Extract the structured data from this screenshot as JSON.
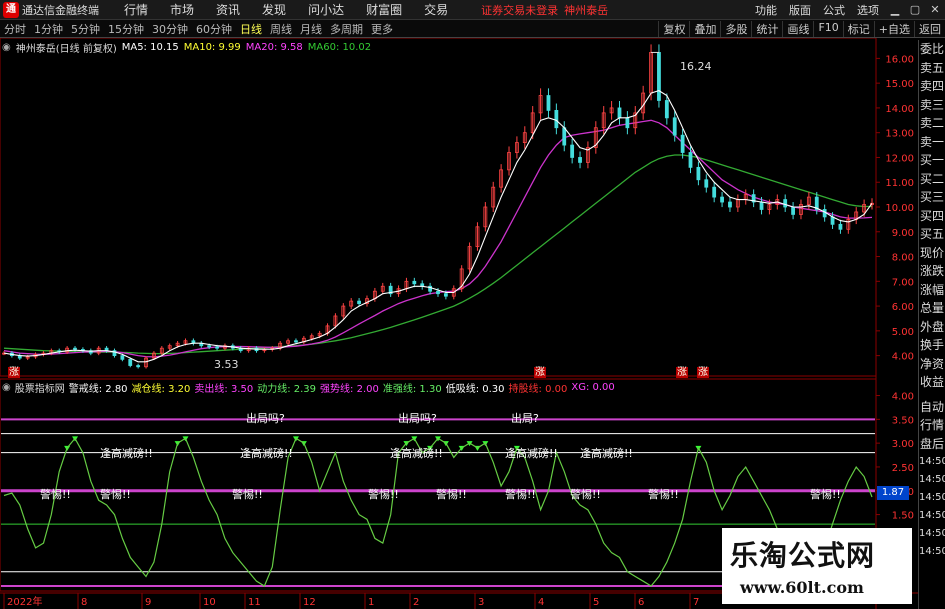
{
  "app": {
    "logo_glyph": "通",
    "title": "通达信金融终端",
    "menus": [
      "行情",
      "市场",
      "资讯",
      "发现",
      "问小达",
      "财富圈",
      "交易"
    ],
    "login_status": "证券交易未登录",
    "stock_name": "神州泰岳",
    "right_menus": [
      "功能",
      "版面",
      "公式",
      "选项"
    ],
    "window_buttons": [
      "▁",
      "▢",
      "✕"
    ]
  },
  "periods": [
    "分时",
    "1分钟",
    "5分钟",
    "15分钟",
    "30分钟",
    "60分钟",
    "日线",
    "周线",
    "月线",
    "多周期",
    "更多"
  ],
  "active_period": "日线",
  "period_tools": [
    "复权",
    "叠加",
    "多股",
    "统计",
    "画线",
    "F10",
    "标记",
    "+自选",
    "返回"
  ],
  "price_chart": {
    "title": "神州泰岳(日线 前复权)",
    "ma": [
      {
        "label": "MA5: 10.15",
        "color": "#ffffff"
      },
      {
        "label": "MA10: 9.99",
        "color": "#ffff33"
      },
      {
        "label": "MA20: 9.58",
        "color": "#ff44ff"
      },
      {
        "label": "MA60: 10.02",
        "color": "#33cc33"
      }
    ],
    "y_ticks": [
      "16.00",
      "15.00",
      "14.00",
      "13.00",
      "12.00",
      "11.00",
      "10.00",
      "9.00",
      "8.00",
      "7.00",
      "6.00",
      "5.00",
      "4.00"
    ],
    "high_label": "16.24",
    "low_label": "3.53",
    "signals": [
      "涨",
      "涨",
      "涨",
      "涨"
    ]
  },
  "indicator": {
    "title": "股票指标网",
    "lines": [
      {
        "label": "警戒线: 2.80",
        "color": "#ffffff"
      },
      {
        "label": "减仓线: 3.20",
        "color": "#ffff33"
      },
      {
        "label": "卖出线: 3.50",
        "color": "#ff44ff"
      },
      {
        "label": "动力线: 2.39",
        "color": "#66ee66"
      },
      {
        "label": "强势线: 2.00",
        "color": "#ff44ff"
      },
      {
        "label": "准强线: 1.30",
        "color": "#66ee66"
      },
      {
        "label": "低吸线: 0.30",
        "color": "#ffffff"
      },
      {
        "label": "持股线: 0.00",
        "color": "#ff3333"
      },
      {
        "label": "XG: 0.00",
        "color": "#ff44ff"
      }
    ],
    "y_ticks": [
      "4.00",
      "3.50",
      "3.00",
      "2.50",
      "2.00",
      "1.50"
    ],
    "current_value": "1.87",
    "label_out": "出局吗?",
    "label_out2": "出局?",
    "label_caution": "逢高减磅!!",
    "label_hold": "警惕!!"
  },
  "x_axis": [
    "2022年",
    "8",
    "9",
    "10",
    "11",
    "12",
    "1",
    "2",
    "3",
    "4",
    "5",
    "6",
    "7"
  ],
  "sidebar": {
    "quote_items": [
      "委比",
      "卖五",
      "卖四",
      "卖三",
      "卖二",
      "卖一",
      "买一",
      "买二",
      "买三",
      "买四",
      "买五",
      "现价",
      "涨跌",
      "涨幅",
      "总量",
      "外盘",
      "换手",
      "净资",
      "收益"
    ],
    "lower_items": [
      "自动",
      "行情",
      "盘后"
    ],
    "times": [
      "14:50",
      "14:50",
      "14:50",
      "14:50",
      "14:50",
      "14:50",
      "14:50",
      "14:50"
    ]
  },
  "watermark": {
    "text": "乐淘公式网",
    "url": "www.60lt.com"
  },
  "chart_data": {
    "type": "line",
    "price_series": {
      "x": [
        0,
        2,
        4,
        6,
        8,
        10,
        12,
        14,
        16,
        18,
        20,
        22,
        24,
        26,
        28,
        30,
        32,
        34,
        36,
        38,
        40,
        42,
        44,
        46,
        48,
        50,
        52,
        54,
        56,
        58,
        60,
        62,
        64,
        66,
        68,
        70,
        72,
        74,
        76,
        78,
        80,
        82,
        84,
        86,
        88,
        90,
        92,
        94,
        96,
        98,
        100,
        102,
        104,
        106,
        108,
        110,
        112,
        114,
        116,
        118,
        120,
        122,
        124,
        126,
        128,
        130,
        132,
        134,
        136,
        138,
        140,
        142,
        144,
        146,
        148,
        150,
        152,
        154,
        156,
        158,
        160,
        162,
        164,
        166,
        168,
        170,
        172,
        174,
        176,
        178,
        180,
        182,
        184,
        186,
        188,
        190,
        192,
        194,
        196,
        198,
        200,
        202,
        204,
        206,
        208,
        210,
        212,
        214,
        216,
        218,
        220
      ],
      "close": [
        4.1,
        4.0,
        3.9,
        3.95,
        4.05,
        4.1,
        4.2,
        4.15,
        4.3,
        4.25,
        4.2,
        4.1,
        4.3,
        4.2,
        4.0,
        3.85,
        3.6,
        3.55,
        3.9,
        4.1,
        4.3,
        4.4,
        4.5,
        4.6,
        4.5,
        4.4,
        4.35,
        4.3,
        4.4,
        4.3,
        4.2,
        4.3,
        4.2,
        4.25,
        4.3,
        4.5,
        4.6,
        4.55,
        4.7,
        4.8,
        4.9,
        5.2,
        5.6,
        6.0,
        6.2,
        6.1,
        6.3,
        6.6,
        6.8,
        6.5,
        6.7,
        7.0,
        6.9,
        6.8,
        6.6,
        6.5,
        6.4,
        6.7,
        7.5,
        8.4,
        9.2,
        10.0,
        10.8,
        11.5,
        12.2,
        12.6,
        13.0,
        13.8,
        14.5,
        13.9,
        13.2,
        12.5,
        12.0,
        11.8,
        12.4,
        13.2,
        13.8,
        14.0,
        13.6,
        13.2,
        13.8,
        14.6,
        16.24,
        14.3,
        13.6,
        12.9,
        12.2,
        11.6,
        11.1,
        10.8,
        10.4,
        10.2,
        10.0,
        10.3,
        10.5,
        10.2,
        9.9,
        10.1,
        10.3,
        10.0,
        9.7,
        10.1,
        10.4,
        9.9,
        9.6,
        9.3,
        9.1,
        9.5,
        9.8,
        10.1,
        10.15
      ],
      "ma5": [
        4.1,
        4.05,
        4.0,
        3.98,
        4.0,
        4.05,
        4.1,
        4.15,
        4.2,
        4.22,
        4.2,
        4.18,
        4.2,
        4.2,
        4.15,
        4.05,
        3.9,
        3.75,
        3.75,
        3.85,
        4.0,
        4.2,
        4.35,
        4.45,
        4.5,
        4.5,
        4.45,
        4.4,
        4.38,
        4.35,
        4.3,
        4.28,
        4.26,
        4.26,
        4.26,
        4.3,
        4.4,
        4.48,
        4.56,
        4.65,
        4.75,
        4.9,
        5.15,
        5.45,
        5.8,
        6.0,
        6.15,
        6.3,
        6.5,
        6.55,
        6.6,
        6.7,
        6.8,
        6.8,
        6.75,
        6.65,
        6.55,
        6.55,
        6.8,
        7.3,
        8.0,
        8.8,
        9.6,
        10.4,
        11.1,
        11.8,
        12.3,
        12.9,
        13.5,
        13.6,
        13.5,
        13.2,
        12.8,
        12.4,
        12.3,
        12.5,
        12.9,
        13.4,
        13.6,
        13.6,
        13.7,
        14.1,
        14.6,
        14.7,
        14.5,
        13.9,
        13.2,
        12.5,
        11.9,
        11.4,
        11.0,
        10.7,
        10.4,
        10.3,
        10.3,
        10.25,
        10.2,
        10.15,
        10.2,
        10.1,
        10.0,
        10.0,
        10.05,
        9.95,
        9.8,
        9.6,
        9.45,
        9.4,
        9.5,
        9.7,
        10.15
      ],
      "ma20": [
        4.2,
        4.15,
        4.1,
        4.08,
        4.06,
        4.05,
        4.06,
        4.08,
        4.1,
        4.12,
        4.14,
        4.15,
        4.16,
        4.17,
        4.16,
        4.12,
        4.06,
        4.0,
        3.96,
        3.95,
        3.98,
        4.02,
        4.08,
        4.15,
        4.22,
        4.28,
        4.32,
        4.35,
        4.36,
        4.37,
        4.37,
        4.36,
        4.35,
        4.34,
        4.33,
        4.34,
        4.36,
        4.38,
        4.42,
        4.47,
        4.53,
        4.62,
        4.75,
        4.92,
        5.1,
        5.28,
        5.45,
        5.62,
        5.8,
        5.95,
        6.1,
        6.22,
        6.32,
        6.42,
        6.5,
        6.55,
        6.58,
        6.6,
        6.7,
        6.9,
        7.2,
        7.6,
        8.1,
        8.6,
        9.2,
        9.8,
        10.4,
        11.0,
        11.6,
        12.1,
        12.5,
        12.8,
        12.9,
        12.95,
        13.0,
        13.05,
        13.1,
        13.2,
        13.3,
        13.35,
        13.4,
        13.45,
        13.5,
        13.4,
        13.2,
        12.9,
        12.6,
        12.3,
        12.0,
        11.7,
        11.4,
        11.1,
        10.9,
        10.7,
        10.55,
        10.4,
        10.3,
        10.2,
        10.15,
        10.1,
        10.0,
        9.95,
        9.9,
        9.85,
        9.8,
        9.7,
        9.6,
        9.55,
        9.55,
        9.56,
        9.58
      ],
      "ma60": [
        4.3,
        4.28,
        4.26,
        4.24,
        4.22,
        4.2,
        4.19,
        4.18,
        4.17,
        4.16,
        4.15,
        4.14,
        4.14,
        4.14,
        4.14,
        4.13,
        4.12,
        4.1,
        4.09,
        4.08,
        4.08,
        4.09,
        4.1,
        4.12,
        4.14,
        4.16,
        4.18,
        4.2,
        4.22,
        4.24,
        4.26,
        4.28,
        4.3,
        4.32,
        4.34,
        4.36,
        4.38,
        4.4,
        4.43,
        4.46,
        4.5,
        4.55,
        4.6,
        4.66,
        4.72,
        4.8,
        4.88,
        4.96,
        5.05,
        5.14,
        5.24,
        5.34,
        5.44,
        5.55,
        5.66,
        5.77,
        5.88,
        6.0,
        6.15,
        6.32,
        6.5,
        6.7,
        6.92,
        7.15,
        7.4,
        7.65,
        7.9,
        8.15,
        8.4,
        8.65,
        8.9,
        9.15,
        9.4,
        9.65,
        9.9,
        10.15,
        10.4,
        10.65,
        10.9,
        11.15,
        11.4,
        11.6,
        11.8,
        11.95,
        12.05,
        12.1,
        12.1,
        12.05,
        12.0,
        11.9,
        11.8,
        11.7,
        11.6,
        11.5,
        11.4,
        11.3,
        11.2,
        11.1,
        11.0,
        10.9,
        10.8,
        10.7,
        10.6,
        10.5,
        10.4,
        10.3,
        10.2,
        10.1,
        10.05,
        10.02,
        10.02
      ],
      "ylim": [
        3.5,
        16.5
      ]
    },
    "indicator_series": {
      "x": [
        0,
        2,
        4,
        6,
        8,
        10,
        12,
        14,
        16,
        18,
        20,
        22,
        24,
        26,
        28,
        30,
        32,
        34,
        36,
        38,
        40,
        42,
        44,
        46,
        48,
        50,
        52,
        54,
        56,
        58,
        60,
        62,
        64,
        66,
        68,
        70,
        72,
        74,
        76,
        78,
        80,
        82,
        84,
        86,
        88,
        90,
        92,
        94,
        96,
        98,
        100,
        102,
        104,
        106,
        108,
        110,
        112,
        114,
        116,
        118,
        120,
        122,
        124,
        126,
        128,
        130,
        132,
        134,
        136,
        138,
        140,
        142,
        144,
        146,
        148,
        150,
        152,
        154,
        156,
        158,
        160,
        162,
        164,
        166,
        168,
        170,
        172,
        174,
        176,
        178,
        180,
        182,
        184,
        186,
        188,
        190,
        192,
        194,
        196,
        198,
        200,
        202,
        204,
        206,
        208,
        210,
        212,
        214,
        216,
        218,
        220
      ],
      "power": [
        1.9,
        1.95,
        1.7,
        1.2,
        0.8,
        0.9,
        1.5,
        2.4,
        2.9,
        3.1,
        2.8,
        2.2,
        1.8,
        1.7,
        1.5,
        1.0,
        0.6,
        0.4,
        0.2,
        0.5,
        1.3,
        2.4,
        3.0,
        3.1,
        2.7,
        2.2,
        1.8,
        1.5,
        1.0,
        0.7,
        0.5,
        0.3,
        0.1,
        0.0,
        0.4,
        1.6,
        2.7,
        3.1,
        3.0,
        2.6,
        2.0,
        2.4,
        2.8,
        2.2,
        1.8,
        1.5,
        1.4,
        1.0,
        0.9,
        1.5,
        2.8,
        3.0,
        3.1,
        2.8,
        2.9,
        3.1,
        3.0,
        2.7,
        2.9,
        3.0,
        2.9,
        3.0,
        2.6,
        2.1,
        2.4,
        2.9,
        2.7,
        2.2,
        1.6,
        2.0,
        2.8,
        2.4,
        1.9,
        1.7,
        1.6,
        1.3,
        0.9,
        0.7,
        0.6,
        0.3,
        0.2,
        0.1,
        0.0,
        0.2,
        0.5,
        0.9,
        1.4,
        2.2,
        2.9,
        2.6,
        2.0,
        1.6,
        1.9,
        2.3,
        2.5,
        2.2,
        1.9,
        1.6,
        1.2,
        0.8,
        0.5,
        0.3,
        0.2,
        0.4,
        0.8,
        1.3,
        1.8,
        2.2,
        2.5,
        2.3,
        1.87
      ],
      "ylim": [
        0,
        4.2
      ],
      "levels": {
        "sell": 3.5,
        "reduce": 3.2,
        "warn": 2.8,
        "strong": 2.0,
        "quasi": 1.3,
        "low": 0.3,
        "hold": 0.0
      }
    }
  }
}
